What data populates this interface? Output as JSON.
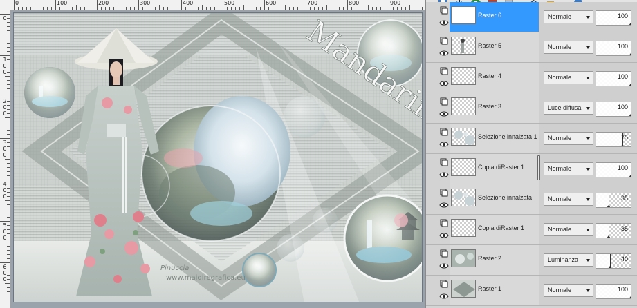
{
  "canvas": {
    "ruler_top_labels": [
      "0",
      "100",
      "200",
      "300",
      "400",
      "500",
      "600",
      "700",
      "800",
      "900"
    ],
    "ruler_left_labels": [
      "0",
      "100",
      "200",
      "300",
      "400",
      "500",
      "600"
    ],
    "artwork": {
      "title_text": "Mandarina",
      "watermark_line1": "Pinuccia",
      "watermark_line2": "www.maidiregrafica.eu",
      "colors": {
        "sky": "#dde3e1",
        "diamond": "#9aa49e",
        "dress": "#b9c4c0",
        "hat": "#ecece6",
        "blossom": "#e79aa4",
        "water": "#8fc8d6"
      }
    }
  },
  "toolbar": {
    "icons": [
      "new-raster-layer-icon",
      "merge-down-icon",
      "mask-icon",
      "adjustment-layer-icon",
      "duplicate-layer-icon",
      "link-icon",
      "lock-icon",
      "properties-icon"
    ]
  },
  "layers": [
    {
      "name": "Raster 6",
      "blend": "Normale",
      "opacity": "100",
      "selected": true,
      "thumb": "blank"
    },
    {
      "name": "Raster 5",
      "blend": "Normale",
      "opacity": "100",
      "selected": false,
      "thumb": "figure"
    },
    {
      "name": "Raster 4",
      "blend": "Normale",
      "opacity": "100",
      "selected": false,
      "thumb": "checker"
    },
    {
      "name": "Raster 3",
      "blend": "Luce diffusa",
      "opacity": "100",
      "selected": false,
      "thumb": "checker"
    },
    {
      "name": "Selezione innalzata 1",
      "blend": "Normale",
      "opacity": "75",
      "selected": false,
      "thumb": "circles"
    },
    {
      "name": "Copia diRaster 1",
      "blend": "Normale",
      "opacity": "100",
      "selected": false,
      "thumb": "checker"
    },
    {
      "name": "Selezione innalzata",
      "blend": "Normale",
      "opacity": "35",
      "selected": false,
      "thumb": "circles"
    },
    {
      "name": "Copia diRaster 1",
      "blend": "Normale",
      "opacity": "35",
      "selected": false,
      "thumb": "checker"
    },
    {
      "name": "Raster 2",
      "blend": "Luminanza",
      "opacity": "40",
      "selected": false,
      "thumb": "image"
    },
    {
      "name": "Raster 1",
      "blend": "Normale",
      "opacity": "100",
      "selected": false,
      "thumb": "pattern"
    }
  ]
}
